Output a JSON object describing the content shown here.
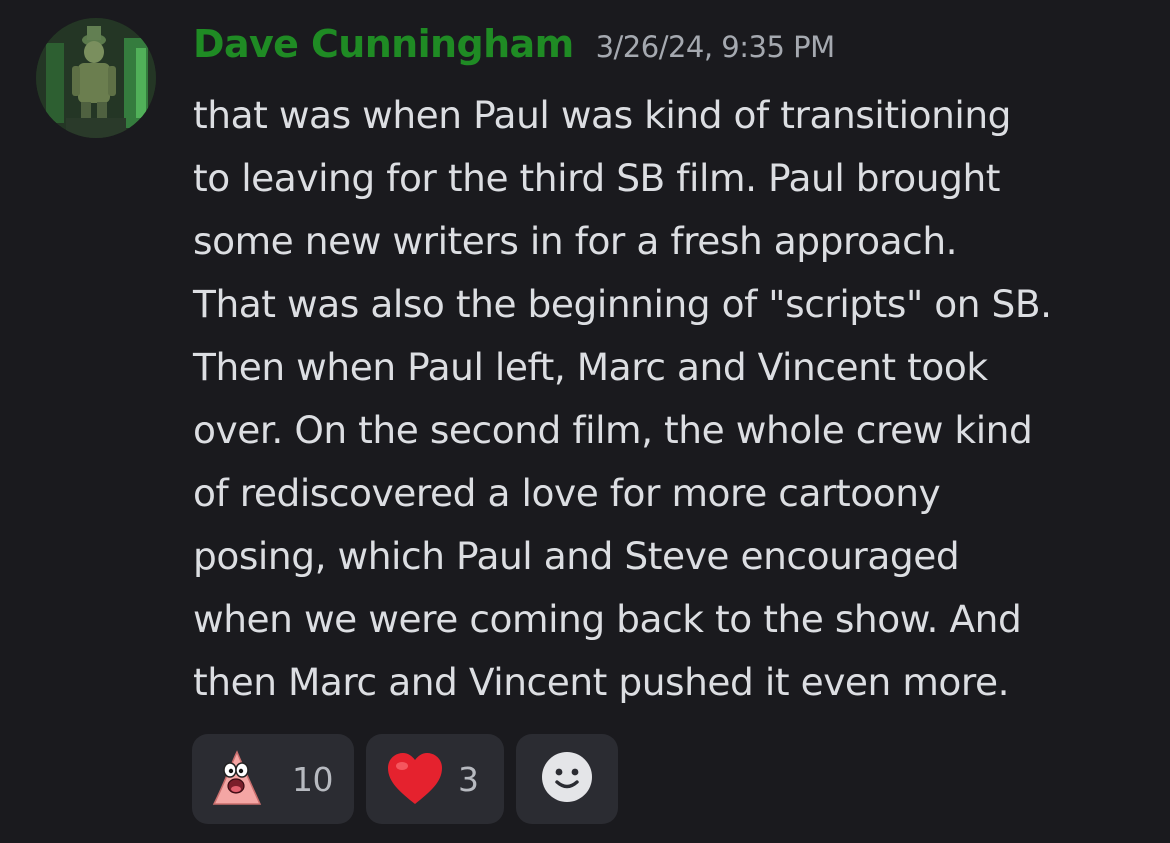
{
  "message": {
    "author": "Dave Cunningham",
    "timestamp": "3/26/24, 9:35 PM",
    "author_color": "#1f8b24",
    "lines": [
      "that was when Paul was kind of transitioning",
      "to leaving for the third SB film. Paul brought",
      "some new writers in for a fresh approach.",
      "That was also the beginning of \"scripts\" on SB.",
      "Then when Paul left, Marc and Vincent took",
      "over. On the second film, the whole crew kind",
      "of rediscovered a love for more cartoony",
      "posing, which Paul and Steve encouraged",
      "when we were coming back to the show. And",
      "then Marc and Vincent pushed it even more."
    ]
  },
  "reactions": [
    {
      "emoji": "patrick-star-icon",
      "count": "10"
    },
    {
      "emoji": "red-heart-icon",
      "count": "3"
    }
  ],
  "add_reaction": {
    "icon": "smiley-face-icon"
  }
}
